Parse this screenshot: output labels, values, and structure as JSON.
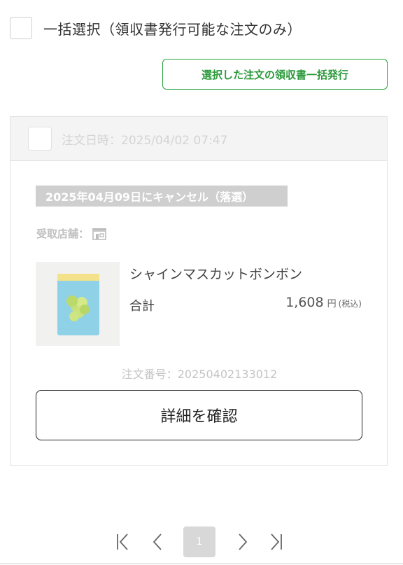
{
  "select_all": {
    "label": "一括選択（領収書発行可能な注文のみ）"
  },
  "bulk_issue_button": {
    "label": "選択した注文の領収書一括発行"
  },
  "order": {
    "date_label": "注文日時：2025/04/02 07:47",
    "status": "2025年04月09日にキャンセル（落選）",
    "store_label": "受取店舗：",
    "product": {
      "name": "シャインマスカットボンボン",
      "total_label": "合計",
      "price": "1,608",
      "currency": "円",
      "tax_note": "(税込)",
      "package_text": "シャインマスカットボンボン"
    },
    "order_number": "注文番号：20250402133012",
    "detail_button": "詳細を確認"
  },
  "pagination": {
    "current_page": "1"
  },
  "colors": {
    "accent_green": "#2aa13e",
    "badge_gray": "#cfcfcf"
  },
  "icons": [
    "store-icon",
    "first-page-icon",
    "prev-page-icon",
    "next-page-icon",
    "last-page-icon"
  ]
}
